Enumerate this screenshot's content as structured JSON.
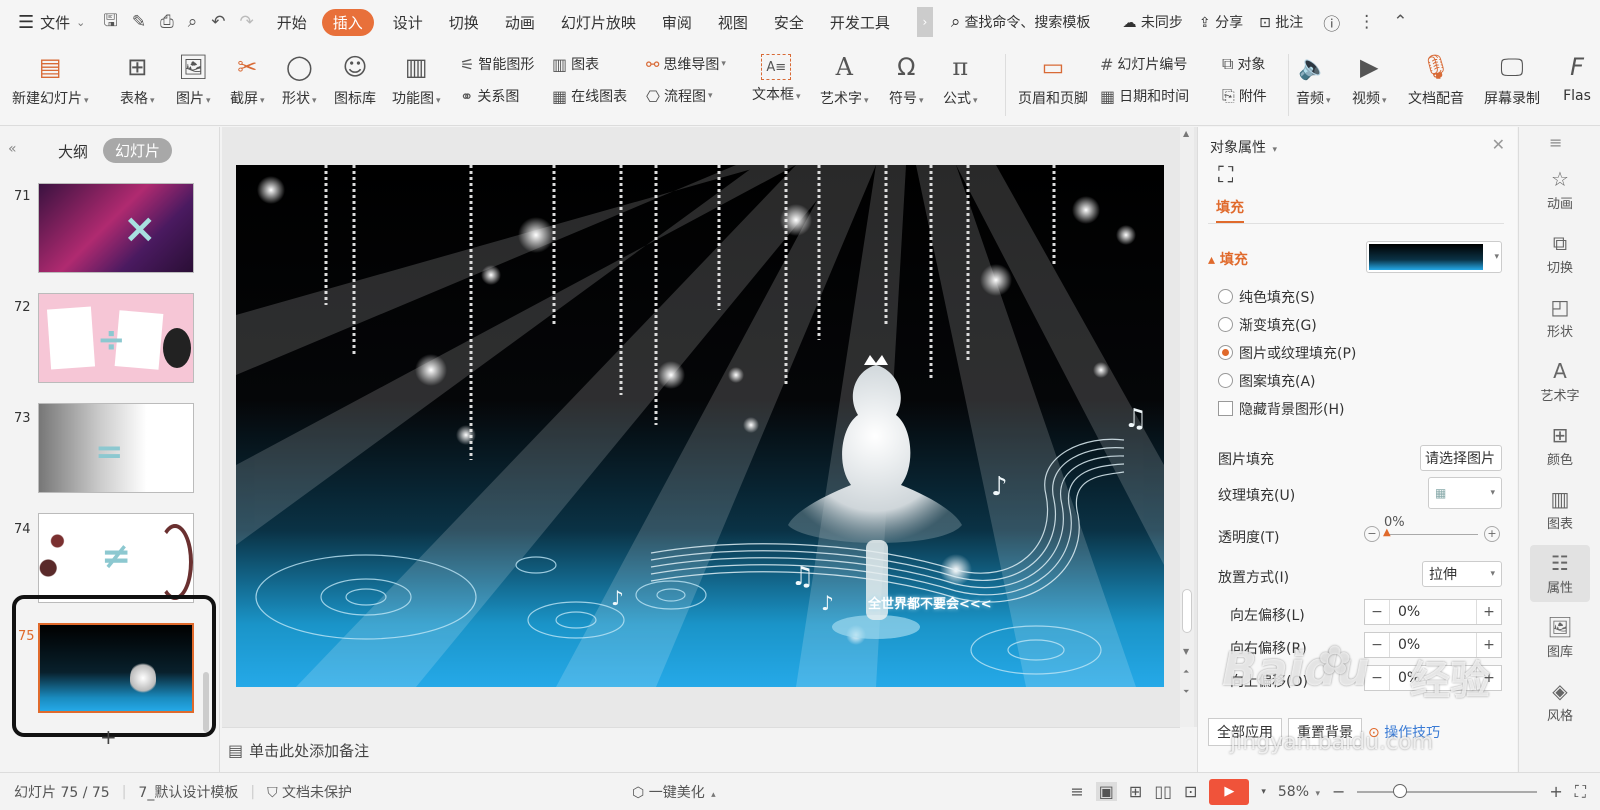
{
  "menubar": {
    "file": "文件",
    "tabs": [
      "开始",
      "插入",
      "设计",
      "切换",
      "动画",
      "幻灯片放映",
      "审阅",
      "视图",
      "安全",
      "开发工具"
    ],
    "active_tab": "插入",
    "search": "查找命令、搜索模板",
    "sync": "未同步",
    "share": "分享",
    "comment": "批注"
  },
  "ribbon": {
    "new_slide": "新建幻灯片",
    "table": "表格",
    "picture": "图片",
    "screenshot": "截屏",
    "shape": "形状",
    "icon_lib": "图标库",
    "func_chart": "功能图",
    "smart_art": "智能图形",
    "chart": "图表",
    "mind_map": "思维导图",
    "relation": "关系图",
    "online_chart": "在线图表",
    "flowchart": "流程图",
    "textbox": "文本框",
    "wordart": "艺术字",
    "symbol": "符号",
    "formula": "公式",
    "header_footer": "页眉和页脚",
    "slide_number": "幻灯片编号",
    "object": "对象",
    "datetime": "日期和时间",
    "attachment": "附件",
    "audio": "音频",
    "video": "视频",
    "dubbing": "文档配音",
    "screen_record": "屏幕录制",
    "flash": "Flas"
  },
  "left_pane": {
    "tab_outline": "大纲",
    "tab_slides": "幻灯片",
    "slides": [
      {
        "num": "71"
      },
      {
        "num": "72"
      },
      {
        "num": "73"
      },
      {
        "num": "74"
      },
      {
        "num": "75"
      }
    ]
  },
  "notes": "单击此处添加备注",
  "right_panel": {
    "title": "对象属性",
    "tab": "填充",
    "section": "填充",
    "options": [
      "纯色填充(S)",
      "渐变填充(G)",
      "图片或纹理填充(P)",
      "图案填充(A)"
    ],
    "selected_option": "图片或纹理填充(P)",
    "hide_bg": "隐藏背景图形(H)",
    "pic_fill_label": "图片填充",
    "pic_fill_value": "请选择图片",
    "texture_label": "纹理填充(U)",
    "transparency_label": "透明度(T)",
    "transparency_value": "0%",
    "placement_label": "放置方式(I)",
    "placement_value": "拉伸",
    "offset_left_label": "向左偏移(L)",
    "offset_left_value": "0%",
    "offset_right_label": "向右偏移(R)",
    "offset_right_value": "0%",
    "offset_up_label": "向上偏移(O)",
    "offset_up_value": "0%",
    "apply_all": "全部应用",
    "reset_bg": "重置背景",
    "tips": "操作技巧"
  },
  "right_toolbar": [
    "动画",
    "切换",
    "形状",
    "艺术字",
    "颜色",
    "图表",
    "属性",
    "图库",
    "风格"
  ],
  "status": {
    "slide_info": "幻灯片 75 / 75",
    "template": "7_默认设计模板",
    "protect": "文档未保护",
    "beautify": "一键美化",
    "zoom": "58%"
  },
  "watermark": {
    "brand": "Baidu",
    "cn": "经验",
    "url": "jingyan.baidu.com"
  },
  "slide_text": "全世界都不要会<<<"
}
